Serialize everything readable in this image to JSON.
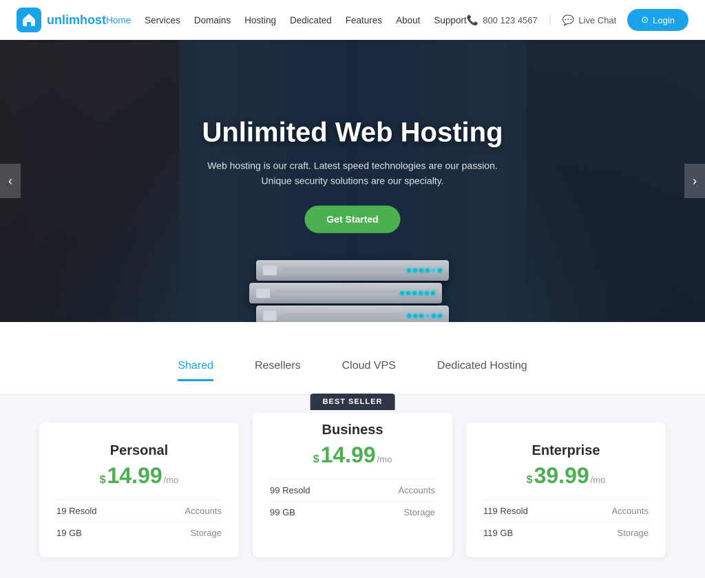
{
  "brand": {
    "logo_text_regular": "unlim",
    "logo_text_accent": "host",
    "logo_icon": "🏠"
  },
  "nav": {
    "links": [
      {
        "label": "Home",
        "active": true
      },
      {
        "label": "Services"
      },
      {
        "label": "Domains"
      },
      {
        "label": "Hosting"
      },
      {
        "label": "Dedicated"
      },
      {
        "label": "Features"
      },
      {
        "label": "About"
      },
      {
        "label": "Support"
      }
    ]
  },
  "header": {
    "phone": "800 123 4567",
    "chat_label": "Live Chat",
    "login_label": "Login"
  },
  "hero": {
    "title": "Unlimited Web Hosting",
    "subtitle_line1": "Web hosting is our craft. Latest speed technologies are our passion.",
    "subtitle_line2": "Unique security solutions are our specialty.",
    "cta_label": "Get Started"
  },
  "hosting_tabs": {
    "tabs": [
      {
        "label": "Shared",
        "active": true
      },
      {
        "label": "Resellers"
      },
      {
        "label": "Cloud VPS"
      },
      {
        "label": "Dedicated Hosting"
      }
    ]
  },
  "pricing": {
    "cards": [
      {
        "id": "personal",
        "title": "Personal",
        "price": "14.99",
        "period": "/mo",
        "featured": false,
        "badge": null,
        "features": [
          {
            "label": "Resold",
            "value": "19",
            "unit": "Accounts"
          },
          {
            "label": "",
            "value": "19 GB",
            "unit": "Storage"
          }
        ]
      },
      {
        "id": "business",
        "title": "Business",
        "price": "14.99",
        "period": "/mo",
        "featured": true,
        "badge": "Best Seller",
        "features": [
          {
            "label": "Resold",
            "value": "99",
            "unit": "Accounts"
          },
          {
            "label": "",
            "value": "99 GB",
            "unit": "Storage"
          }
        ]
      },
      {
        "id": "enterprise",
        "title": "Enterprise",
        "price": "39.99",
        "period": "/mo",
        "featured": false,
        "badge": null,
        "features": [
          {
            "label": "Resold",
            "value": "119",
            "unit": "Accounts"
          },
          {
            "label": "",
            "value": "119 GB",
            "unit": "Storage"
          }
        ]
      }
    ]
  },
  "colors": {
    "accent": "#1aa3e8",
    "green": "#4caf50",
    "dark": "#2d3748"
  }
}
